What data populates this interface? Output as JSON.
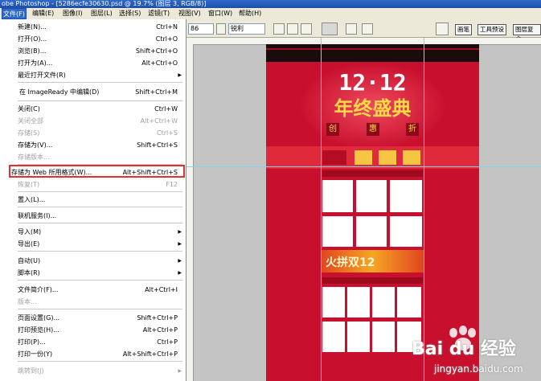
{
  "window": {
    "title": "obe Photoshop - [5286ecfe30630.psd @ 19.7% (图层 3, RGB/8)]"
  },
  "menubar": {
    "items": [
      {
        "label": "文件(F)",
        "active": true
      },
      {
        "label": "编辑(E)"
      },
      {
        "label": "图像(I)"
      },
      {
        "label": "图层(L)"
      },
      {
        "label": "选择(S)"
      },
      {
        "label": "滤镜(T)"
      },
      {
        "label": "视图(V)"
      },
      {
        "label": "窗口(W)"
      },
      {
        "label": "帮助(H)"
      }
    ]
  },
  "options": {
    "size_value": "86",
    "aa_value": "锐利",
    "tabs": [
      "画笔",
      "工具预设",
      "图层复合"
    ]
  },
  "file_menu": {
    "items": [
      {
        "label": "新建(N)...",
        "shortcut": "Ctrl+N"
      },
      {
        "label": "打开(O)...",
        "shortcut": "Ctrl+O"
      },
      {
        "label": "浏览(B)...",
        "shortcut": "Shift+Ctrl+O"
      },
      {
        "label": "打开为(A)...",
        "shortcut": "Alt+Ctrl+O"
      },
      {
        "label": "最近打开文件(R)",
        "shortcut": "",
        "submenu": true
      },
      {
        "label": "在 ImageReady 中编辑(D)",
        "shortcut": "Shift+Ctrl+M"
      },
      {
        "label": "关闭(C)",
        "shortcut": "Ctrl+W"
      },
      {
        "label": "关闭全部",
        "shortcut": "Alt+Ctrl+W",
        "disabled": true
      },
      {
        "label": "存储(S)",
        "shortcut": "Ctrl+S",
        "disabled": true
      },
      {
        "label": "存储为(V)...",
        "shortcut": "Shift+Ctrl+S"
      },
      {
        "label": "存储版本...",
        "shortcut": "",
        "disabled": true
      },
      {
        "label": "存储为 Web 所用格式(W)...",
        "shortcut": "Alt+Shift+Ctrl+S",
        "highlighted": true
      },
      {
        "label": "恢复(T)",
        "shortcut": "F12",
        "disabled": true
      },
      {
        "label": "置入(L)...",
        "shortcut": ""
      },
      {
        "label": "联机服务(I)...",
        "shortcut": ""
      },
      {
        "label": "导入(M)",
        "shortcut": "",
        "submenu": true
      },
      {
        "label": "导出(E)",
        "shortcut": "",
        "submenu": true
      },
      {
        "label": "自动(U)",
        "shortcut": "",
        "submenu": true
      },
      {
        "label": "脚本(R)",
        "shortcut": "",
        "submenu": true
      },
      {
        "label": "文件简介(F)...",
        "shortcut": "Alt+Ctrl+I"
      },
      {
        "label": "版本...",
        "shortcut": "",
        "disabled": true
      },
      {
        "label": "页面设置(G)...",
        "shortcut": "Shift+Ctrl+P"
      },
      {
        "label": "打印预览(H)...",
        "shortcut": "Alt+Ctrl+P"
      },
      {
        "label": "打印(P)...",
        "shortcut": "Ctrl+P"
      },
      {
        "label": "打印一份(Y)",
        "shortcut": "Alt+Shift+Ctrl+P"
      },
      {
        "label": "跳转到(J)",
        "shortcut": "",
        "submenu": true,
        "disabled": true
      }
    ]
  },
  "canvas": {
    "date": "12·12",
    "headline": "年终盛典",
    "tags": [
      "创",
      "惠",
      "折"
    ],
    "banner": "火拼双12",
    "background_color": "#c8102e"
  },
  "watermark": {
    "brand": "Bai du 经验",
    "url": "jingyan.baidu.com"
  }
}
